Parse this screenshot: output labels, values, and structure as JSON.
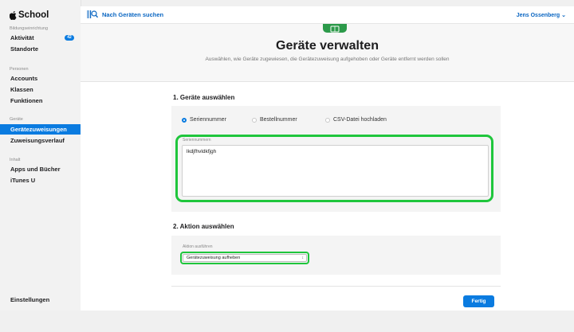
{
  "brand": {
    "name": "School"
  },
  "sidebar": {
    "sections": [
      {
        "label": "Bildungseinrichtung",
        "items": [
          {
            "label": "Aktivität",
            "badge": "42"
          },
          {
            "label": "Standorte"
          }
        ]
      },
      {
        "label": "Personen",
        "items": [
          {
            "label": "Accounts"
          },
          {
            "label": "Klassen"
          },
          {
            "label": "Funktionen"
          }
        ]
      },
      {
        "label": "Geräte",
        "items": [
          {
            "label": "Gerätezuweisungen",
            "active": true
          },
          {
            "label": "Zuweisungsverlauf"
          }
        ]
      },
      {
        "label": "Inhalt",
        "items": [
          {
            "label": "Apps und Bücher"
          },
          {
            "label": "iTunes U"
          }
        ]
      }
    ],
    "footer": "Einstellungen"
  },
  "topbar": {
    "search_label": "Nach Geräten suchen",
    "user": "Jens Ossenberg"
  },
  "header": {
    "title": "Geräte verwalten",
    "subtitle": "Auswählen, wie Geräte zugewiesen, die Gerätezuweisung aufgehoben oder Geräte entfernt werden sollen"
  },
  "step1": {
    "heading": "1. Geräte auswählen",
    "options": [
      "Seriennummer",
      "Bestellnummer",
      "CSV-Datei hochladen"
    ],
    "selected_option": "Seriennummer",
    "field_label": "Seriennummern",
    "field_value": "lkdjfhvldkfjgh"
  },
  "step2": {
    "heading": "2. Aktion auswählen",
    "field_label": "Aktion ausführen",
    "selected_action": "Gerätezuweisung aufheben"
  },
  "done_button": "Fertig",
  "colors": {
    "accent": "#0a7be0",
    "highlight": "#1fc63c",
    "header_icon": "#2c9a4a"
  }
}
